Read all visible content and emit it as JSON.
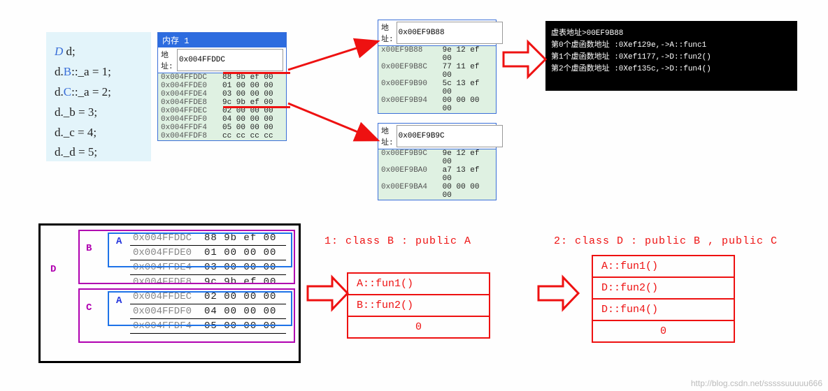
{
  "code": {
    "l1a": "D",
    "l1b": " d;",
    "l2a": "B",
    "l2b": "::_a = 1;",
    "l2p": "d.",
    "l3a": "C",
    "l3b": "::_a = 2;",
    "l3p": "d.",
    "l4": "d._b = 3;",
    "l5": "d._c = 4;",
    "l6": "d._d = 5;"
  },
  "mem1": {
    "title": "内存 1",
    "addrLabel": "地址:",
    "addrValue": "0x004FFDDC",
    "rows": [
      {
        "addr": "0x004FFDDC",
        "bytes": "88 9b ef 00"
      },
      {
        "addr": "0x004FFDE0",
        "bytes": "01 00 00 00"
      },
      {
        "addr": "0x004FFDE4",
        "bytes": "03 00 00 00"
      },
      {
        "addr": "0x004FFDE8",
        "bytes": "9c 9b ef 00"
      },
      {
        "addr": "0x004FFDEC",
        "bytes": "02 00 00 00"
      },
      {
        "addr": "0x004FFDF0",
        "bytes": "04 00 00 00"
      },
      {
        "addr": "0x004FFDF4",
        "bytes": "05 00 00 00"
      },
      {
        "addr": "0x004FFDF8",
        "bytes": "cc cc cc cc"
      }
    ]
  },
  "mem2": {
    "addrLabel": "地址:",
    "addrValue": "0x00EF9B88",
    "rows": [
      {
        "addr": "x00EF9B88",
        "bytes": "9e 12 ef 00"
      },
      {
        "addr": "0x00EF9B8C",
        "bytes": "77 11 ef 00"
      },
      {
        "addr": "0x00EF9B90",
        "bytes": "5c 13 ef 00"
      },
      {
        "addr": "0x00EF9B94",
        "bytes": "00 00 00 00"
      }
    ]
  },
  "mem3": {
    "addrLabel": "地址:",
    "addrValue": "0x00EF9B9C",
    "rows": [
      {
        "addr": "0x00EF9B9C",
        "bytes": "9e 12 ef 00"
      },
      {
        "addr": "0x00EF9BA0",
        "bytes": "a7 13 ef 00"
      },
      {
        "addr": "0x00EF9BA4",
        "bytes": "00 00 00 00"
      }
    ]
  },
  "console": {
    "l1": "虚表地址>00EF9B88",
    "l2": "第0个虚函数地址 :0Xef129e,->A::func1",
    "l3": "第1个虚函数地址 :0Xef1177,->D::fun2()",
    "l4": "第2个虚函数地址 :0Xef135c,->D::fun4()"
  },
  "lower": {
    "D": "D",
    "B": "B",
    "C": "C",
    "A": "A",
    "rows": [
      {
        "addr": "0x004FFDDC",
        "bytes": "88 9b ef 00"
      },
      {
        "addr": "0x004FFDE0",
        "bytes": "01 00 00 00"
      },
      {
        "addr": "0x004FFDE4",
        "bytes": "03 00 00 00"
      },
      {
        "addr": "0x004FFDE8",
        "bytes": "9c 9b ef 00"
      },
      {
        "addr": "0x004FFDEC",
        "bytes": "02 00 00 00"
      },
      {
        "addr": "0x004FFDF0",
        "bytes": "04 00 00 00"
      },
      {
        "addr": "0x004FFDF4",
        "bytes": "05 00 00 00"
      }
    ]
  },
  "cap1": "1: class B : public A",
  "cap2": "2: class D : public B , public C",
  "vt1": [
    "A::fun1()",
    "B::fun2()",
    "0"
  ],
  "vt2": [
    "A::fun1()",
    "D::fun2()",
    "D::fun4()",
    "0"
  ],
  "watermark": "http://blog.csdn.net/sssssuuuuu666"
}
